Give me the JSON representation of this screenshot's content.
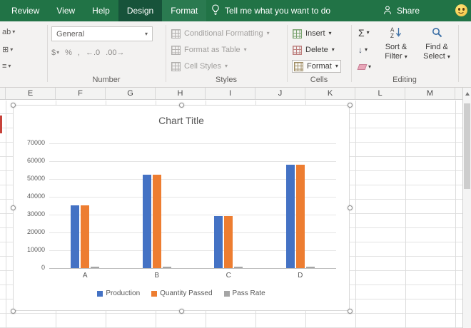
{
  "theme": {
    "ribbon_green": "#217346",
    "active_tab_green": "#17533a",
    "contextual_tab_green": "#2a7a50"
  },
  "icons": {
    "dropdown": "▾",
    "autosum": "Σ",
    "fill_down": "↓",
    "wrap_stub": "ab",
    "merge_stub": "⊞",
    "align_stub": "≡"
  },
  "titlebar": {
    "tabs": [
      {
        "label": "Review",
        "style": "normal"
      },
      {
        "label": "View",
        "style": "normal"
      },
      {
        "label": "Help",
        "style": "normal"
      },
      {
        "label": "Design",
        "style": "active"
      },
      {
        "label": "Format",
        "style": "contextual"
      }
    ],
    "tell_me": "Tell me what you want to do",
    "share_label": "Share"
  },
  "ribbon": {
    "number_group": {
      "label": "Number",
      "format_value": "General",
      "small_buttons": [
        {
          "name": "accounting-format-icon",
          "glyph": "$"
        },
        {
          "name": "percent-style-icon",
          "glyph": "%"
        },
        {
          "name": "comma-style-icon",
          "glyph": ","
        },
        {
          "name": "increase-decimal-icon",
          "glyph": "←.0"
        },
        {
          "name": "decrease-decimal-icon",
          "glyph": ".00→"
        }
      ]
    },
    "styles_group": {
      "label": "Styles",
      "buttons": [
        "Conditional Formatting",
        "Format as Table",
        "Cell Styles"
      ]
    },
    "cells_group": {
      "label": "Cells",
      "buttons": [
        "Insert",
        "Delete",
        "Format"
      ]
    },
    "editing_group": {
      "label": "Editing",
      "big_buttons": [
        "Sort & Filter",
        "Find & Select"
      ]
    }
  },
  "sheet": {
    "visible_columns": [
      "E",
      "F",
      "G",
      "H",
      "I",
      "J",
      "K",
      "L",
      "M"
    ]
  },
  "chart_data": {
    "type": "bar",
    "title": "Chart Title",
    "categories": [
      "A",
      "B",
      "C",
      "D"
    ],
    "series": [
      {
        "name": "Production",
        "color": "#4472c4",
        "values": [
          35000,
          52500,
          29000,
          58000
        ]
      },
      {
        "name": "Quantity Passed",
        "color": "#ed7d31",
        "values": [
          35000,
          52500,
          29000,
          58000
        ]
      },
      {
        "name": "Pass Rate",
        "color": "#a5a5a5",
        "values": [
          99,
          99,
          99,
          99
        ]
      }
    ],
    "xlabel": "",
    "ylabel": "",
    "ylim": [
      0,
      70000
    ],
    "yticks": [
      0,
      10000,
      20000,
      30000,
      40000,
      50000,
      60000,
      70000
    ],
    "grid": true,
    "legend_position": "bottom"
  }
}
